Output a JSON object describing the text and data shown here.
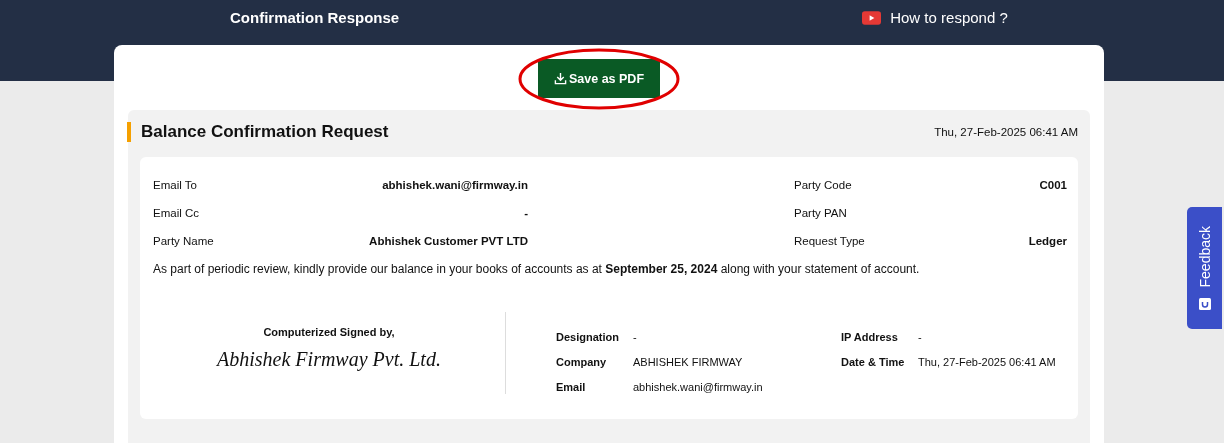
{
  "header": {
    "title": "Confirmation Response",
    "help_link": "How to respond ?"
  },
  "save_button": {
    "label": "Save as PDF",
    "circled": true
  },
  "request": {
    "title": "Balance Confirmation Request",
    "timestamp": "Thu, 27-Feb-2025 06:41 AM",
    "fields_left": [
      {
        "label": "Email To",
        "value": "abhishek.wani@firmway.in"
      },
      {
        "label": "Email Cc",
        "value": "-"
      },
      {
        "label": "Party Name",
        "value": "Abhishek Customer PVT LTD"
      }
    ],
    "fields_right": [
      {
        "label": "Party Code",
        "value": "C001"
      },
      {
        "label": "Party PAN"
      },
      {
        "label": "Request Type",
        "value": "Ledger"
      }
    ],
    "message": "As part of periodic review, kindly provide our balance in your books of accounts as at **September 25, 2024** along with your statement of account.",
    "signature": {
      "heading": "Computerized Signed by,",
      "signature": "Abhishek Firmway Pvt. Ltd.",
      "details_left": [
        {
          "label": "Designation",
          "value": "-"
        },
        {
          "label": "Company",
          "value": "ABHISHEK FIRMWAY"
        },
        {
          "label": "Email",
          "value": "abhishek.wani@firmway.in"
        }
      ],
      "details_right": [
        {
          "label": "IP Address",
          "value": "-"
        },
        {
          "label": "Date & Time",
          "value": "Thu, 27-Feb-2025 06:41 AM"
        }
      ]
    }
  },
  "feedback_tab": {
    "label": "Feedback"
  }
}
